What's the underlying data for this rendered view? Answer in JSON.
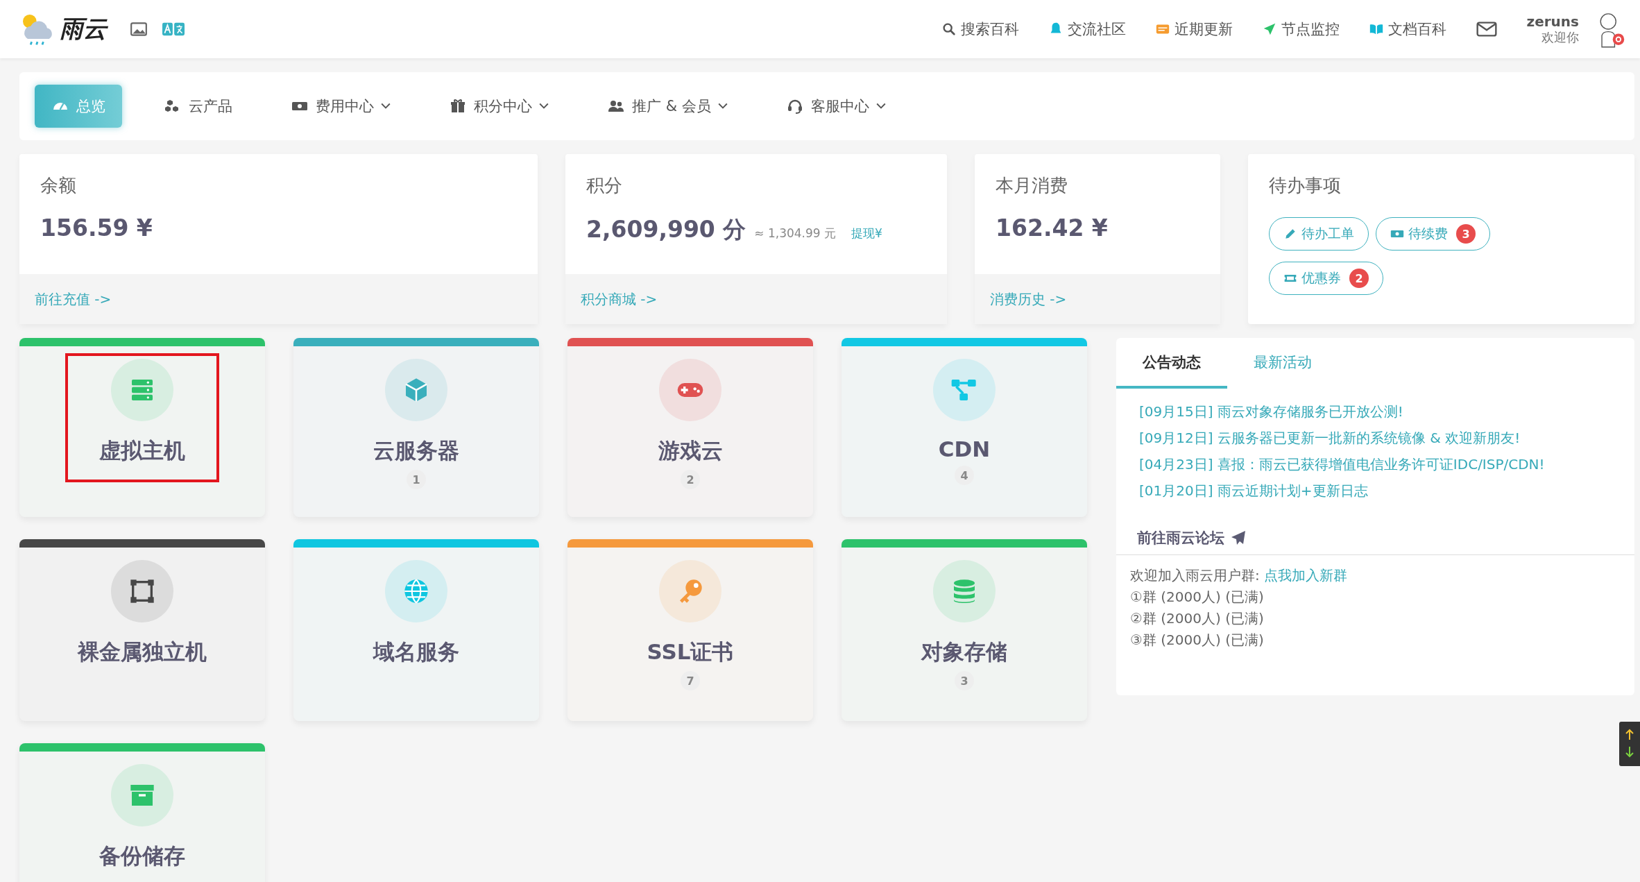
{
  "header": {
    "brand": "雨云",
    "links": [
      {
        "kind": "search",
        "label": "搜索百科"
      },
      {
        "kind": "bell",
        "label": "交流社区"
      },
      {
        "kind": "card",
        "label": "近期更新"
      },
      {
        "kind": "plane",
        "label": "节点监控"
      },
      {
        "kind": "book",
        "label": "文档百科"
      }
    ],
    "user": {
      "name": "zeruns",
      "greeting": "欢迎你"
    }
  },
  "nav": [
    {
      "kind": "gauge",
      "label": "总览",
      "selected": true,
      "dropdown": false
    },
    {
      "kind": "cubes",
      "label": "云产品",
      "selected": false,
      "dropdown": false
    },
    {
      "kind": "money",
      "label": "费用中心",
      "selected": false,
      "dropdown": true
    },
    {
      "kind": "gift",
      "label": "积分中心",
      "selected": false,
      "dropdown": true
    },
    {
      "kind": "users",
      "label": "推广 & 会员",
      "selected": false,
      "dropdown": true
    },
    {
      "kind": "headset",
      "label": "客服中心",
      "selected": false,
      "dropdown": true
    }
  ],
  "stats": [
    {
      "title": "余额",
      "value": "156.59 ¥",
      "link": "前往充值 ->"
    },
    {
      "title": "积分",
      "value": "2,609,990 分",
      "note": "≈ 1,304.99 元",
      "action": "提现¥",
      "link": "积分商城 ->"
    },
    {
      "title": "本月消费",
      "value": "162.42 ¥",
      "link": "消费历史 ->"
    }
  ],
  "todo": {
    "title": "待办事项",
    "items": [
      {
        "kind": "pencil",
        "label": "待办工单"
      },
      {
        "kind": "money",
        "label": "待续费",
        "count": "3"
      },
      {
        "kind": "ticket",
        "label": "优惠券",
        "count": "2"
      }
    ]
  },
  "products": [
    {
      "kind": "server",
      "title": "虚拟主机",
      "color": "#2dc26b",
      "highlighted": true
    },
    {
      "kind": "cube",
      "title": "云服务器",
      "count": "1",
      "color": "#3aafbc",
      "highlighted": false
    },
    {
      "kind": "gamepad",
      "title": "游戏云",
      "count": "2",
      "color": "#e05252",
      "highlighted": false
    },
    {
      "kind": "nodes",
      "title": "CDN",
      "count": "4",
      "color": "#12c8e4",
      "highlighted": false
    },
    {
      "kind": "frame",
      "title": "裸金属独立机",
      "color": "#474747",
      "highlighted": false
    },
    {
      "kind": "globe",
      "title": "域名服务",
      "color": "#0fc6e0",
      "highlighted": false
    },
    {
      "kind": "key",
      "title": "SSL证书",
      "count": "7",
      "color": "#f5993d",
      "highlighted": false
    },
    {
      "kind": "database",
      "title": "对象存储",
      "count": "3",
      "color": "#2dc26b",
      "highlighted": false
    },
    {
      "kind": "archive",
      "title": "备份储存",
      "color": "#2dc26b",
      "highlighted": false
    }
  ],
  "news_panel": {
    "tabs": [
      {
        "label": "公告动态",
        "selected": true
      },
      {
        "label": "最新活动",
        "selected": false
      }
    ],
    "items": [
      "[09月15日] 雨云对象存储服务已开放公测!",
      "[09月12日] 云服务器已更新一批新的系统镜像 & 欢迎新朋友!",
      "[04月23日] 喜报：雨云已获得增值电信业务许可证IDC/ISP/CDN!",
      "[01月20日] 雨云近期计划+更新日志"
    ],
    "forum_title": "前往雨云论坛",
    "group_intro": "欢迎加入雨云用户群: ",
    "group_link": "点我加入新群",
    "groups": [
      "①群 (2000人) (已满)",
      "②群 (2000人) (已满)",
      "③群 (2000人) (已满)"
    ]
  }
}
